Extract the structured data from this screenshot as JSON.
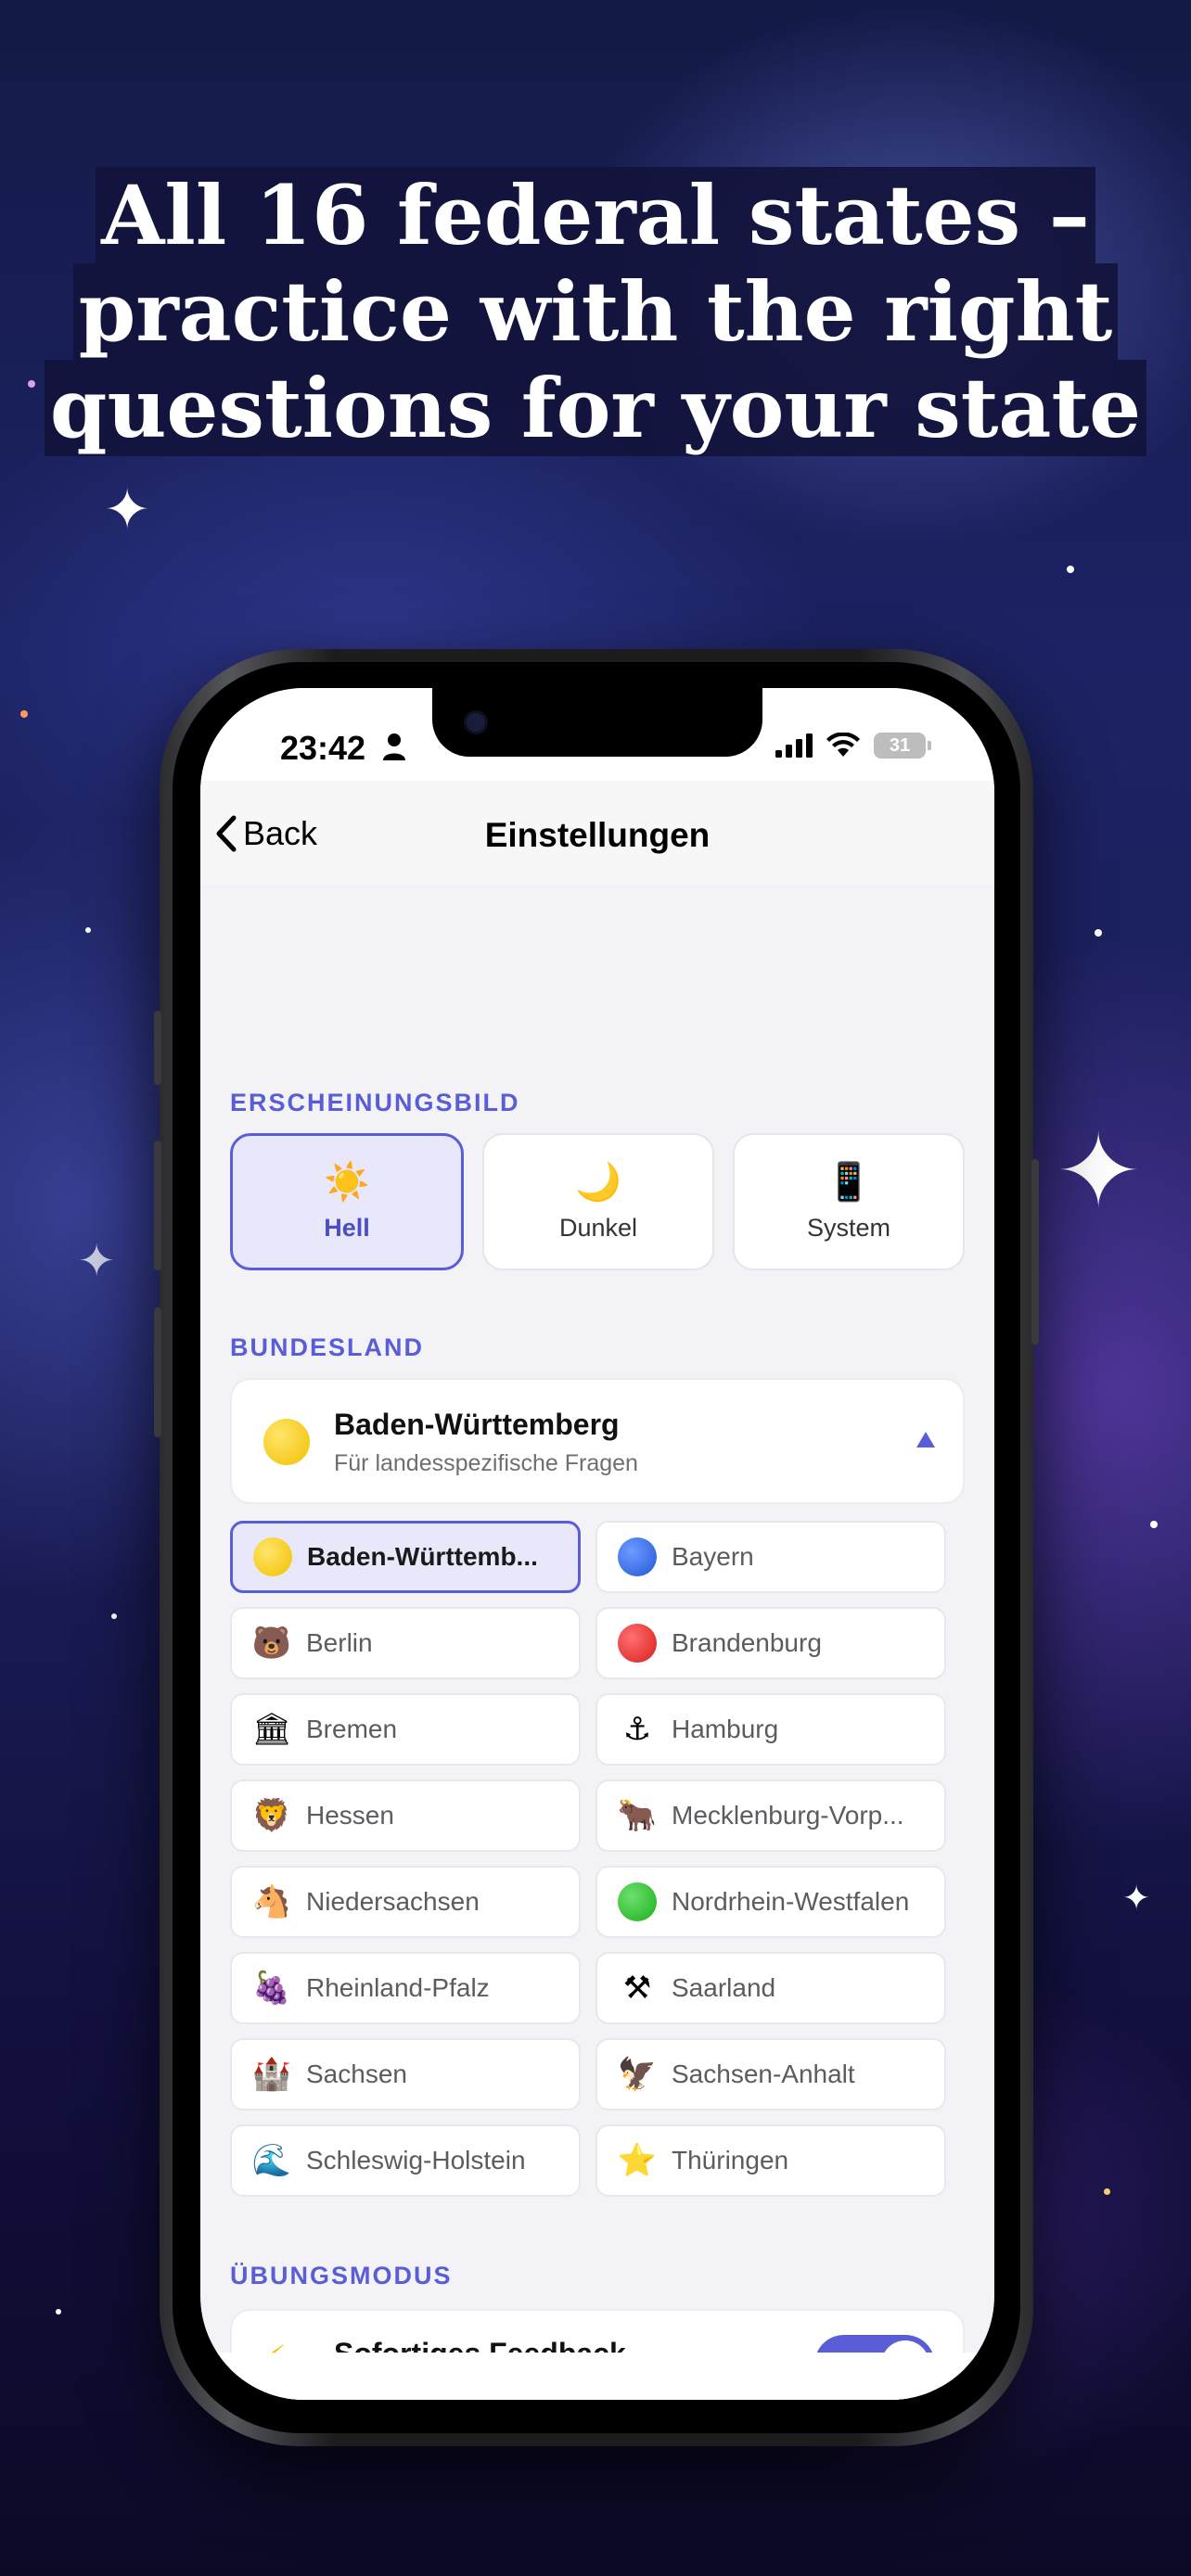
{
  "headline": {
    "line1": "All 16 federal states –",
    "line2": "practice with the right",
    "line3": "questions for your state"
  },
  "status_bar": {
    "time": "23:42",
    "battery": "31"
  },
  "nav": {
    "back_label": "Back",
    "title": "Einstellungen"
  },
  "appearance": {
    "section_label": "ERSCHEINUNGSBILD",
    "options": [
      {
        "icon": "sun-icon",
        "emoji": "☀️",
        "label": "Hell",
        "selected": true
      },
      {
        "icon": "moon-icon",
        "emoji": "🌙",
        "label": "Dunkel",
        "selected": false
      },
      {
        "icon": "phone-icon",
        "emoji": "📱",
        "label": "System",
        "selected": false
      }
    ]
  },
  "state": {
    "section_label": "BUNDESLAND",
    "selected_name": "Baden-Württemberg",
    "selected_subtitle": "Für landesspezifische Fragen",
    "options": [
      {
        "label": "Baden-Württemb...",
        "icon": "yellow-circle-icon",
        "glyph": "",
        "selected": true
      },
      {
        "label": "Bayern",
        "icon": "blue-circle-icon",
        "glyph": ""
      },
      {
        "label": "Berlin",
        "icon": "bear-icon",
        "glyph": "🐻"
      },
      {
        "label": "Brandenburg",
        "icon": "red-circle-icon",
        "glyph": ""
      },
      {
        "label": "Bremen",
        "icon": "classical-building-icon",
        "glyph": "🏛"
      },
      {
        "label": "Hamburg",
        "icon": "anchor-icon",
        "glyph": "⚓"
      },
      {
        "label": "Hessen",
        "icon": "lion-icon",
        "glyph": "🦁"
      },
      {
        "label": "Mecklenburg-Vorp...",
        "icon": "ox-icon",
        "glyph": "🐂"
      },
      {
        "label": "Niedersachsen",
        "icon": "horse-icon",
        "glyph": "🐴"
      },
      {
        "label": "Nordrhein-Westfalen",
        "icon": "green-circle-icon",
        "glyph": ""
      },
      {
        "label": "Rheinland-Pfalz",
        "icon": "grapes-icon",
        "glyph": "🍇"
      },
      {
        "label": "Saarland",
        "icon": "hammer-pick-icon",
        "glyph": "⚒"
      },
      {
        "label": "Sachsen",
        "icon": "castle-icon",
        "glyph": "🏰"
      },
      {
        "label": "Sachsen-Anhalt",
        "icon": "eagle-icon",
        "glyph": "🦅"
      },
      {
        "label": "Schleswig-Holstein",
        "icon": "wave-icon",
        "glyph": "🌊"
      },
      {
        "label": "Thüringen",
        "icon": "star-icon",
        "glyph": "⭐"
      }
    ]
  },
  "practice": {
    "section_label": "ÜBUNGSMODUS",
    "feedback_label": "Sofortiges Feedback",
    "feedback_enabled": true
  },
  "colors": {
    "accent": "#5a5ed6",
    "selected_bg": "#e9e8fb",
    "yellow": "#f2c000",
    "blue": "#1f57d6",
    "red": "#d91c1c",
    "green": "#1cae1c"
  }
}
